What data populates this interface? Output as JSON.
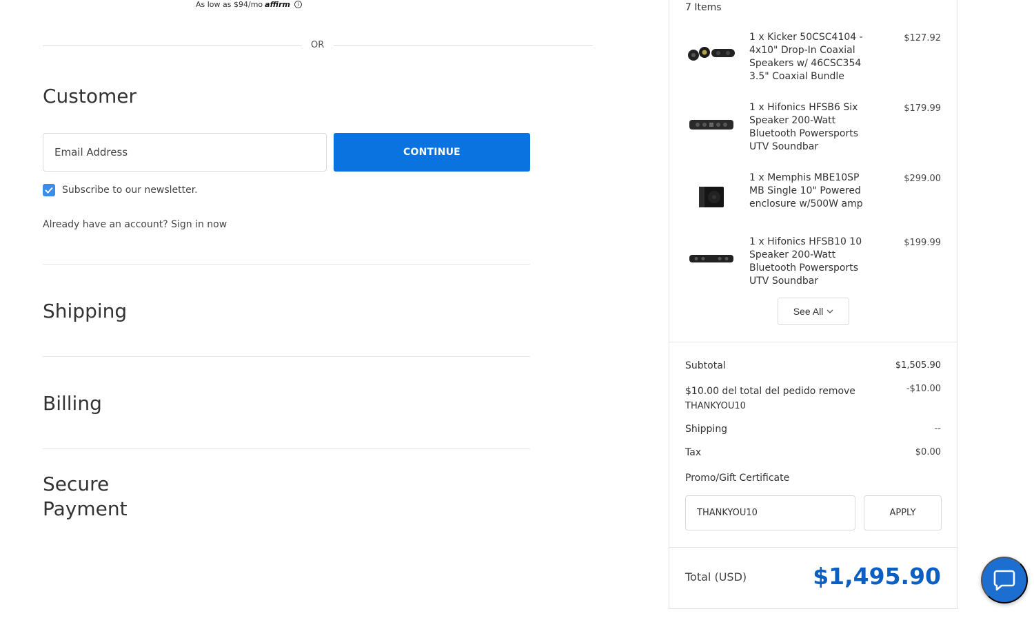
{
  "financing": {
    "prefix": "As low as $94/mo",
    "brand": "affirm",
    "info_icon": "info-circle-icon"
  },
  "divider": {
    "or_label": "OR"
  },
  "customer": {
    "title": "Customer",
    "email_placeholder": "Email Address",
    "continue_label": "CONTINUE",
    "newsletter_label": "Subscribe to our newsletter.",
    "newsletter_checked": true,
    "account_prompt": "Already have an account?",
    "signin_label": "Sign in now"
  },
  "steps": {
    "shipping": "Shipping",
    "billing": "Billing",
    "payment_line1": "Secure",
    "payment_line2": "Payment"
  },
  "summary": {
    "items_count": "7 Items",
    "items": [
      {
        "name": "1 x Kicker 50CSC4104 - 4x10\" Drop-In Coaxial Speakers w/ 46CSC354 3.5\" Coaxial Bundle",
        "price": "$127.92",
        "icon": "speaker-bundle-thumbnail"
      },
      {
        "name": "1 x Hifonics HFSB6 Six Speaker 200-Watt Bluetooth Powersports UTV Soundbar",
        "price": "$179.99",
        "icon": "soundbar-thumbnail"
      },
      {
        "name": "1 x Memphis MBE10SP MB Single 10\" Powered enclosure w/500W amp",
        "price": "$299.00",
        "icon": "subwoofer-box-thumbnail"
      },
      {
        "name": "1 x Hifonics HFSB10 10 Speaker 200-Watt Bluetooth Powersports UTV Soundbar",
        "price": "$199.99",
        "icon": "soundbar-thumbnail"
      }
    ],
    "see_all_label": "See All",
    "subtotal_label": "Subtotal",
    "subtotal_value": "$1,505.90",
    "discount_label": "$10.00 del total del pedido remove",
    "discount_code": "THANKYOU10",
    "discount_value": "-$10.00",
    "shipping_label": "Shipping",
    "shipping_value": "--",
    "tax_label": "Tax",
    "tax_value": "$0.00",
    "promo_label": "Promo/Gift Certificate",
    "promo_value": "THANKYOU10",
    "apply_label": "APPLY",
    "total_label": "Total (USD)",
    "total_value": "$1,495.90"
  },
  "colors": {
    "primary_button": "#0b73e0",
    "total_text": "#0b5fc2",
    "chat_button": "#1c6fd1",
    "checkbox": "#3b8de8"
  },
  "chat": {
    "icon": "chat-bubble-icon"
  }
}
